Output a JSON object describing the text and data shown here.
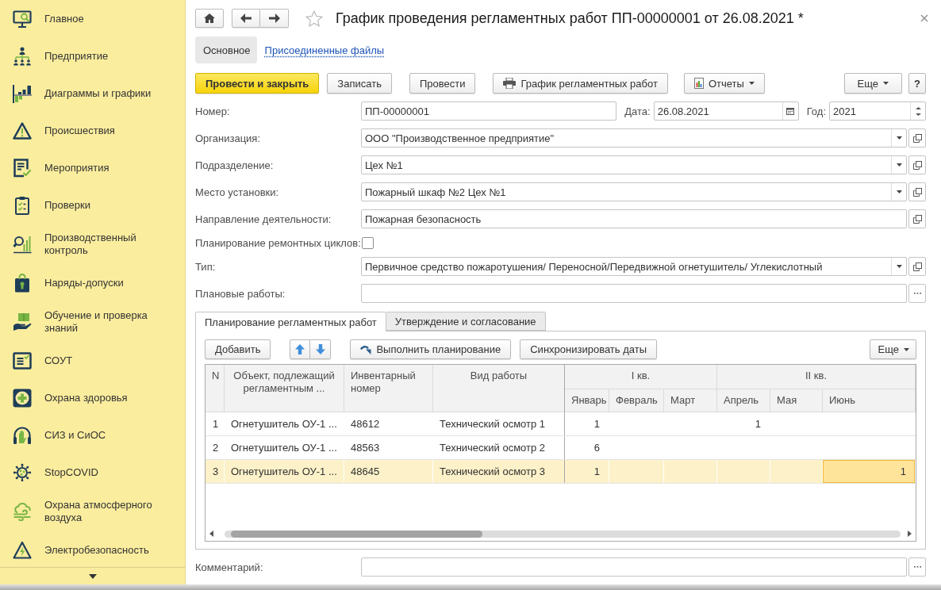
{
  "sidebar": {
    "items": [
      {
        "label": "Главное"
      },
      {
        "label": "Предприятие"
      },
      {
        "label": "Диаграммы и графики"
      },
      {
        "label": "Происшествия"
      },
      {
        "label": "Мероприятия"
      },
      {
        "label": "Проверки"
      },
      {
        "label": "Производственный контроль"
      },
      {
        "label": "Наряды-допуски"
      },
      {
        "label": "Обучение и проверка знаний"
      },
      {
        "label": "СОУТ"
      },
      {
        "label": "Охрана здоровья"
      },
      {
        "label": "СИЗ и СиОС"
      },
      {
        "label": "StopCOVID"
      },
      {
        "label": "Охрана атмосферного воздуха"
      },
      {
        "label": "Электробезопасность"
      }
    ]
  },
  "window": {
    "title": "График проведения регламентных работ ПП-00000001 от 26.08.2021 *"
  },
  "form_tabs": [
    {
      "label": "Основное",
      "selected": true
    },
    {
      "label": "Присоединенные файлы",
      "selected": false
    }
  ],
  "commands": [
    {
      "label": "Провести и закрыть",
      "kind": "primary"
    },
    {
      "label": "Записать",
      "kind": "plain"
    },
    {
      "label": "Провести",
      "kind": "plain"
    },
    {
      "label": "График регламентных работ",
      "kind": "print"
    },
    {
      "label": "Отчеты",
      "kind": "report_menu"
    }
  ],
  "more_button": "Еще",
  "help_button": "?",
  "number": {
    "label": "Номер:",
    "value": "ПП-00000001"
  },
  "date": {
    "label": "Дата:",
    "value": "26.08.2021"
  },
  "year": {
    "label": "Год:",
    "value": "2021"
  },
  "fields": [
    {
      "kind": "select",
      "label": "Организация:",
      "value": "ООО \"Производственное предприятие\""
    },
    {
      "kind": "select",
      "label": "Подразделение:",
      "value": "Цех №1"
    },
    {
      "kind": "select",
      "label": "Место установки:",
      "value": "Пожарный шкаф №2 Цех №1"
    },
    {
      "kind": "reference",
      "label": "Направление деятельности:",
      "value": "Пожарная безопасность"
    },
    {
      "kind": "checkbox",
      "label": "Планирование ремонтных циклов:",
      "checked": false
    },
    {
      "kind": "select",
      "label": "Тип:",
      "value": "Первичное средство пожаротушения/ Переносной/Передвижной огнетушитель/ Углекислотный"
    },
    {
      "kind": "choice",
      "label": "Плановые работы:"
    }
  ],
  "table_tabs": [
    {
      "label": "Планирование регламентных работ",
      "selected": true
    },
    {
      "label": "Утверждение и согласование",
      "selected": false
    }
  ],
  "table_toolbar": {
    "add": "Добавить",
    "run": "Выполнить планирование",
    "sync": "Синхронизировать даты",
    "more": "Еще"
  },
  "table": {
    "columns": [
      {
        "label": "N"
      },
      {
        "label": "Объект, подлежащий регламентным ..."
      },
      {
        "label": "Инвентарный номер"
      },
      {
        "label": "Вид работы"
      }
    ],
    "quarters": [
      {
        "label": "I кв.",
        "months": [
          "Январь",
          "Февраль",
          "Март"
        ]
      },
      {
        "label": "II кв.",
        "months": [
          "Апрель",
          "Мая",
          "Июнь"
        ]
      }
    ],
    "rows": [
      {
        "selected": false,
        "n": "1",
        "object": "Огнетушитель ОУ-1 ...",
        "inventory": "48612",
        "work": "Технический осмотр 1",
        "cells": [
          {
            "value": "1",
            "selected": false
          },
          {
            "selected": false
          },
          {
            "selected": false
          },
          {
            "value": "1",
            "selected": false
          },
          {
            "selected": false
          },
          {
            "selected": false
          }
        ]
      },
      {
        "selected": false,
        "n": "2",
        "object": "Огнетушитель ОУ-1 ...",
        "inventory": "48563",
        "work": "Технический осмотр 2",
        "cells": [
          {
            "value": "6",
            "selected": false
          },
          {
            "selected": false
          },
          {
            "selected": false
          },
          {
            "selected": false
          },
          {
            "selected": false
          },
          {
            "selected": false
          }
        ]
      },
      {
        "selected": true,
        "n": "3",
        "object": "Огнетушитель ОУ-1 ...",
        "inventory": "48645",
        "work": "Технический осмотр 3",
        "cells": [
          {
            "value": "1",
            "selected": false
          },
          {
            "selected": false
          },
          {
            "selected": false
          },
          {
            "selected": false
          },
          {
            "selected": false
          },
          {
            "value": "1",
            "selected": true
          }
        ]
      }
    ]
  },
  "comment": {
    "label": "Комментарий:"
  }
}
